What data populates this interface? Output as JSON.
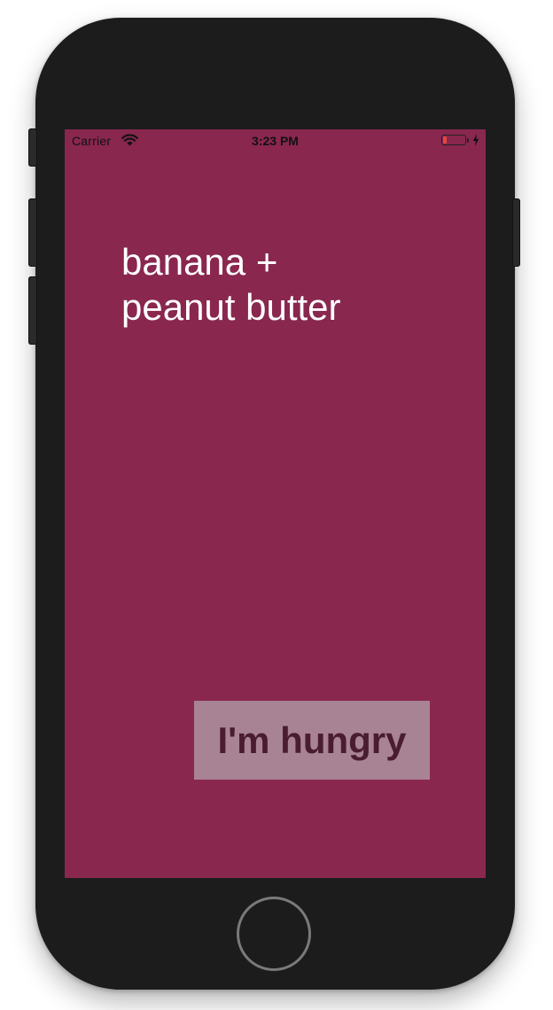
{
  "status_bar": {
    "carrier": "Carrier",
    "time": "3:23 PM",
    "battery_level": 0.15,
    "battery_color": "#e5483d",
    "charging": true,
    "wifi_icon": "wifi-icon",
    "charge_icon": "lightning-bolt-icon"
  },
  "content": {
    "title_line1": "banana +",
    "title_line2": "peanut butter",
    "button_label": "I'm hungry"
  },
  "colors": {
    "screen_background": "#89274f",
    "button_background": "#a88394",
    "button_text": "#4a1c30",
    "title_text": "#ffffff",
    "device_body": "#1c1c1c"
  }
}
